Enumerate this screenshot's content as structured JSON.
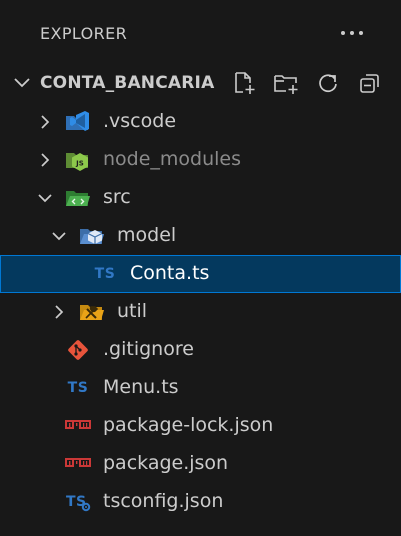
{
  "explorer": {
    "title": "EXPLORER",
    "more_icon": "ellipsis-icon"
  },
  "section": {
    "title": "CONTA_BANCARIA",
    "actions": [
      {
        "name": "new-file-button",
        "icon": "new-file-icon"
      },
      {
        "name": "new-folder-button",
        "icon": "new-folder-icon"
      },
      {
        "name": "refresh-button",
        "icon": "refresh-icon"
      },
      {
        "name": "collapse-all-button",
        "icon": "collapse-all-icon"
      }
    ]
  },
  "tree": [
    {
      "label": ".vscode",
      "kind": "folder",
      "icon": "vscode-folder-icon",
      "expanded": false,
      "depth": 0
    },
    {
      "label": "node_modules",
      "kind": "folder",
      "icon": "node-folder-icon",
      "expanded": false,
      "depth": 0,
      "dimmed": true
    },
    {
      "label": "src",
      "kind": "folder",
      "icon": "src-folder-icon",
      "expanded": true,
      "depth": 0
    },
    {
      "label": "model",
      "kind": "folder",
      "icon": "model-folder-icon",
      "expanded": true,
      "depth": 1
    },
    {
      "label": "Conta.ts",
      "kind": "file",
      "icon": "typescript-icon",
      "icon_text": "TS",
      "depth": 2,
      "selected": true
    },
    {
      "label": "util",
      "kind": "folder",
      "icon": "util-folder-icon",
      "expanded": false,
      "depth": 1
    },
    {
      "label": ".gitignore",
      "kind": "file",
      "icon": "git-icon",
      "depth": 0
    },
    {
      "label": "Menu.ts",
      "kind": "file",
      "icon": "typescript-icon",
      "icon_text": "TS",
      "depth": 0
    },
    {
      "label": "package-lock.json",
      "kind": "file",
      "icon": "npm-icon",
      "depth": 0
    },
    {
      "label": "package.json",
      "kind": "file",
      "icon": "npm-icon",
      "depth": 0
    },
    {
      "label": "tsconfig.json",
      "kind": "file",
      "icon": "tsconfig-icon",
      "icon_text": "TS",
      "depth": 0
    }
  ],
  "colors": {
    "background": "#181818",
    "selected_background": "#04395e",
    "selected_border": "#0078d4",
    "text": "#cccccc",
    "dim_text": "#8b8b8b",
    "typescript_blue": "#3178c6",
    "git_orange": "#e8543b",
    "npm_red": "#cb3837",
    "node_green": "#6fa842",
    "src_green": "#4caf50",
    "util_orange": "#e9a317",
    "vscode_blue": "#2f8ce6"
  }
}
